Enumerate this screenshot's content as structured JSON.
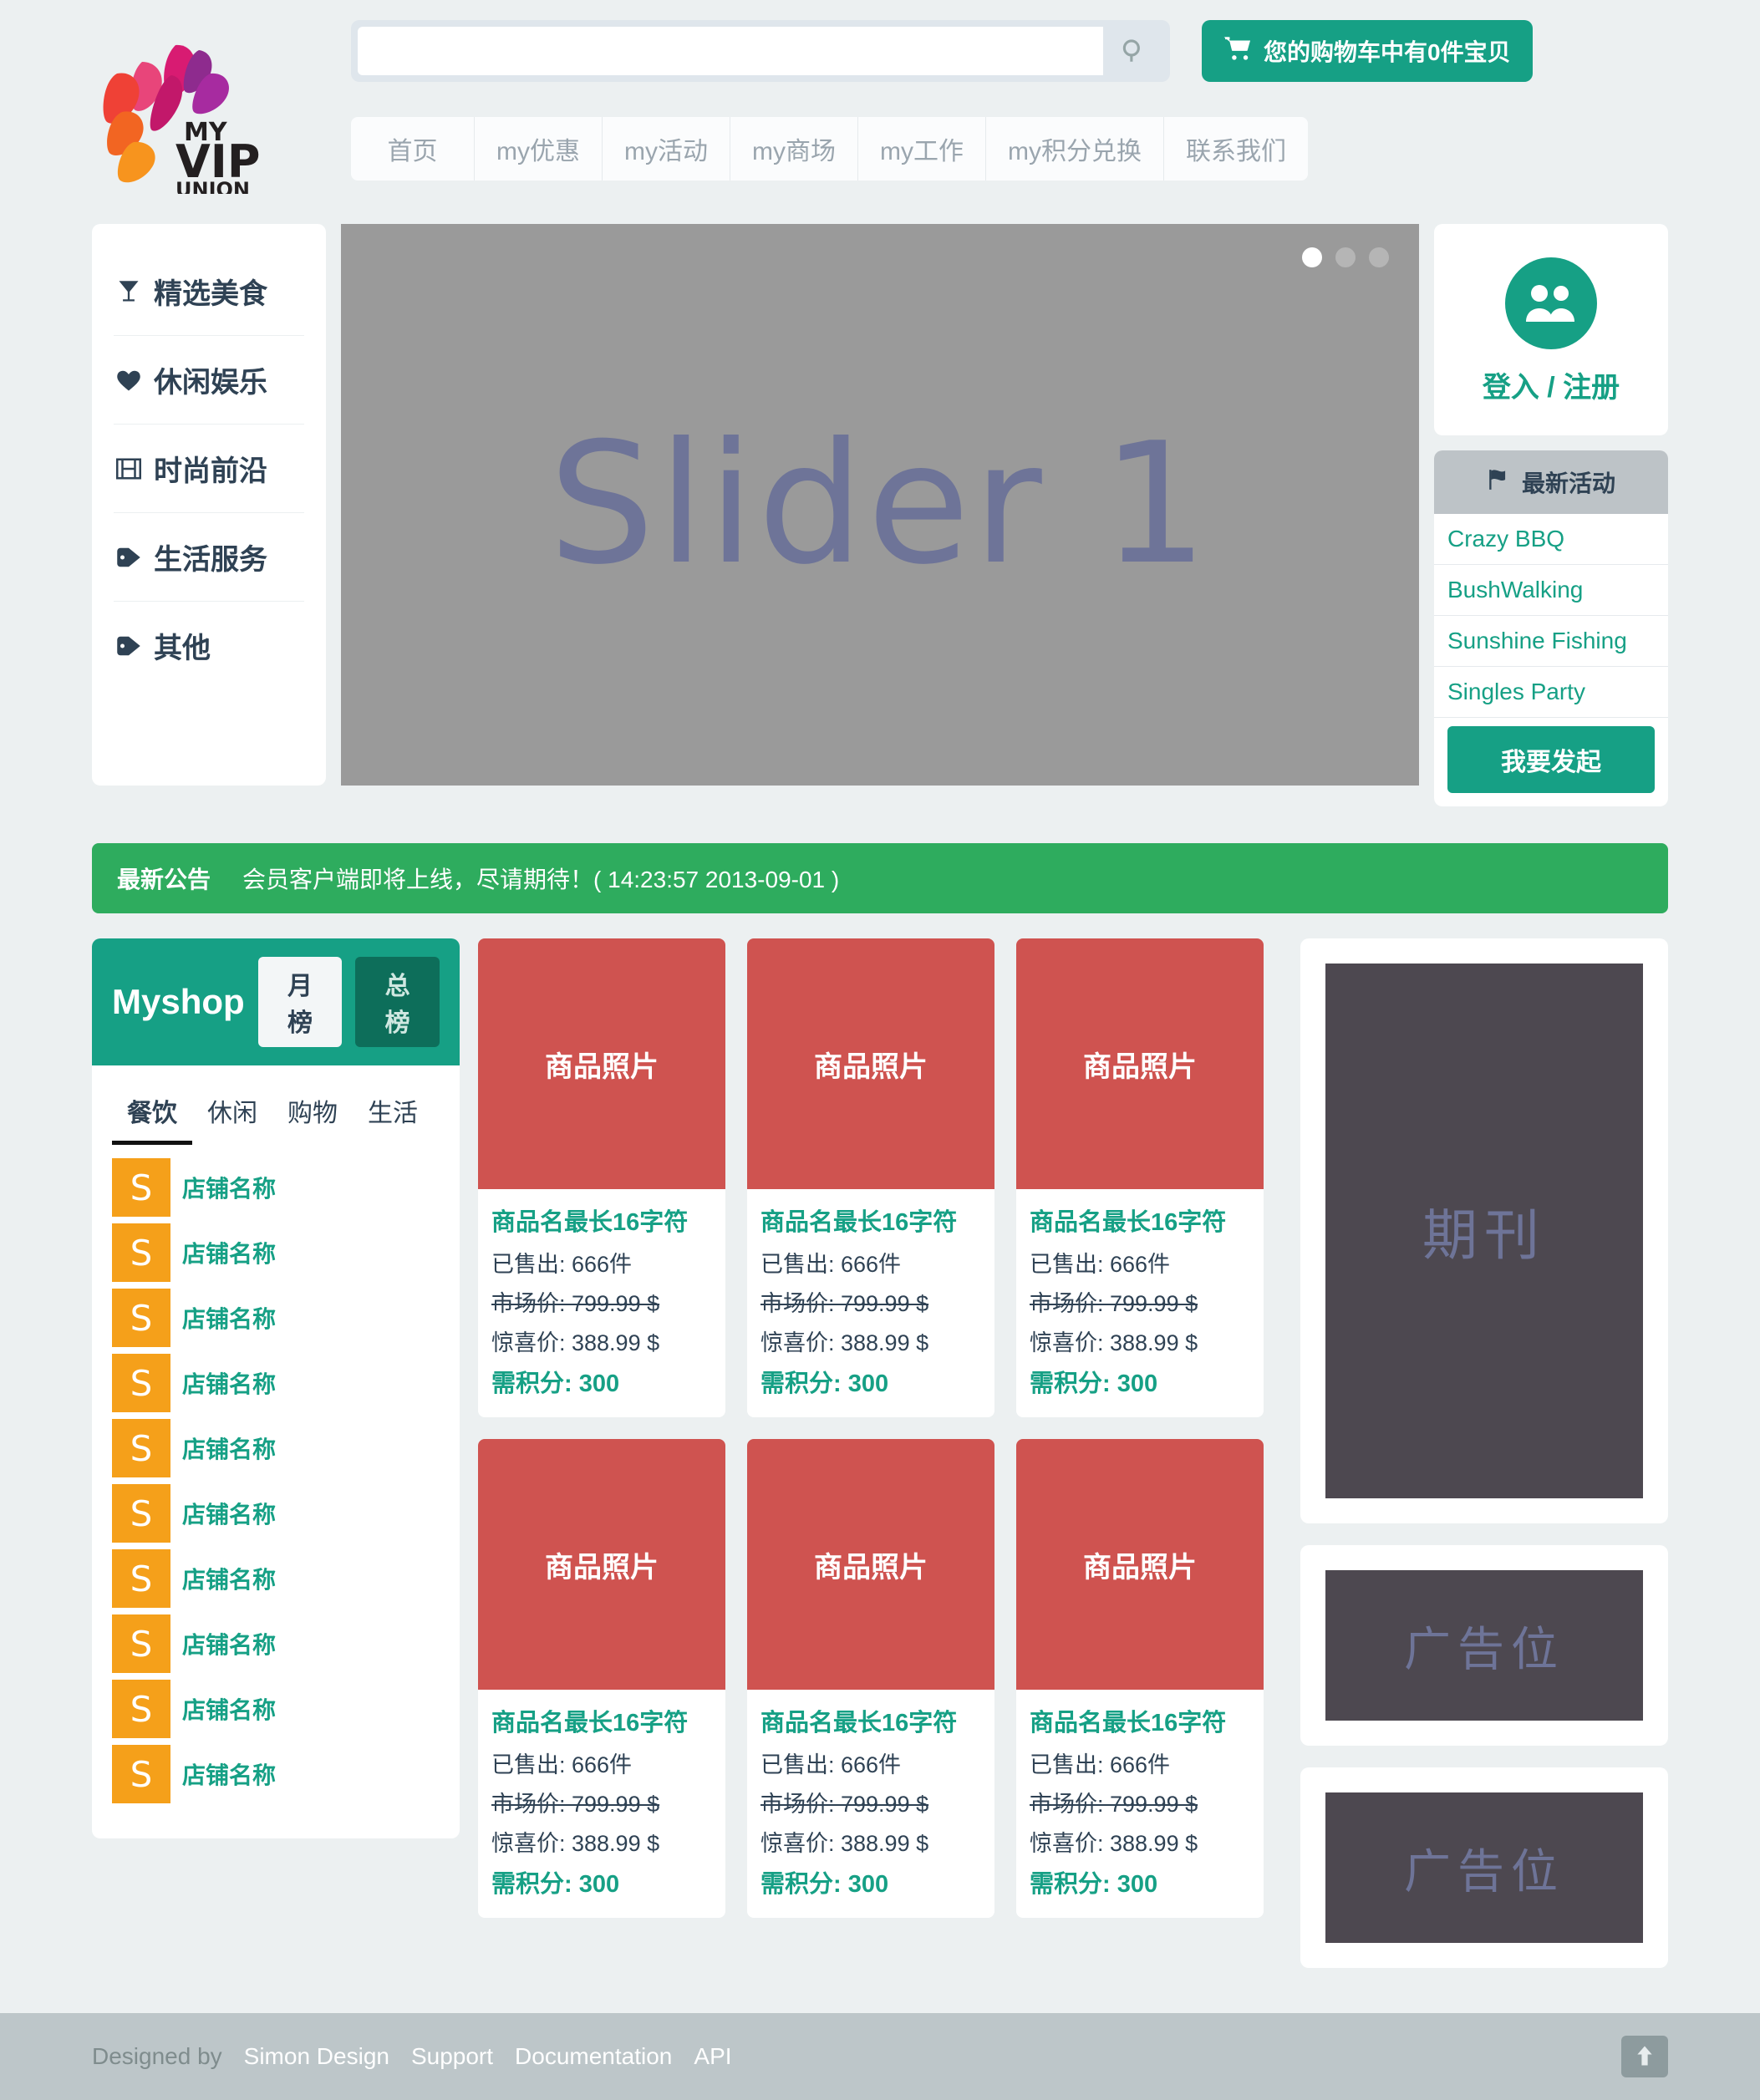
{
  "brand": {
    "name_my": "MY",
    "name_vip": "VIP",
    "name_union": "UNION"
  },
  "search": {
    "value": "",
    "placeholder": "",
    "icon": "search-icon"
  },
  "cart": {
    "label": "您的购物车中有0件宝贝",
    "icon": "shopping-cart-icon",
    "color": "#16a085"
  },
  "nav": {
    "items": [
      {
        "label": "首页"
      },
      {
        "label": "my优惠"
      },
      {
        "label": "my活动"
      },
      {
        "label": "my商场"
      },
      {
        "label": "my工作"
      },
      {
        "label": "my积分兑换"
      },
      {
        "label": "联系我们"
      }
    ]
  },
  "categories": {
    "items": [
      {
        "label": "精选美食",
        "icon": "cocktail-icon"
      },
      {
        "label": "休闲娱乐",
        "icon": "heart-icon"
      },
      {
        "label": "时尚前沿",
        "icon": "film-icon"
      },
      {
        "label": "生活服务",
        "icon": "tag-icon"
      },
      {
        "label": "其他",
        "icon": "tag-icon"
      }
    ]
  },
  "slider": {
    "text": "Slider 1",
    "background": "#9a9a9a",
    "text_color": "#6e7498",
    "dots": [
      {
        "active": true
      },
      {
        "active": false
      },
      {
        "active": false
      }
    ]
  },
  "login": {
    "label": "登入 / 注册",
    "icon": "users-icon",
    "color": "#16a085"
  },
  "activities": {
    "title": "最新活动",
    "title_icon": "flag-icon",
    "items": [
      {
        "label": "Crazy BBQ"
      },
      {
        "label": "BushWalking"
      },
      {
        "label": "Sunshine Fishing"
      },
      {
        "label": "Singles Party"
      }
    ],
    "button_label": "我要发起"
  },
  "announcement": {
    "title": "最新公告",
    "text": "会员客户端即将上线，尽请期待！( 14:23:57 2013-09-01 )",
    "color": "#2eac5e"
  },
  "myshop": {
    "title": "Myshop",
    "rank_month": "月榜",
    "rank_total": "总榜",
    "tabs": [
      {
        "label": "餐饮",
        "active": true
      },
      {
        "label": "休闲",
        "active": false
      },
      {
        "label": "购物",
        "active": false
      },
      {
        "label": "生活",
        "active": false
      }
    ],
    "shops": [
      {
        "logo": "S",
        "name": "店铺名称"
      },
      {
        "logo": "S",
        "name": "店铺名称"
      },
      {
        "logo": "S",
        "name": "店铺名称"
      },
      {
        "logo": "S",
        "name": "店铺名称"
      },
      {
        "logo": "S",
        "name": "店铺名称"
      },
      {
        "logo": "S",
        "name": "店铺名称"
      },
      {
        "logo": "S",
        "name": "店铺名称"
      },
      {
        "logo": "S",
        "name": "店铺名称"
      },
      {
        "logo": "S",
        "name": "店铺名称"
      },
      {
        "logo": "S",
        "name": "店铺名称"
      }
    ]
  },
  "products": {
    "items": [
      {
        "photo_label": "商品照片",
        "name": "商品名最长16字符",
        "sold": "已售出: 666件",
        "market_price": "市场价: 799.99 $",
        "sale_price": "惊喜价: 388.99 $",
        "points": "需积分: 300"
      },
      {
        "photo_label": "商品照片",
        "name": "商品名最长16字符",
        "sold": "已售出: 666件",
        "market_price": "市场价: 799.99 $",
        "sale_price": "惊喜价: 388.99 $",
        "points": "需积分: 300"
      },
      {
        "photo_label": "商品照片",
        "name": "商品名最长16字符",
        "sold": "已售出: 666件",
        "market_price": "市场价: 799.99 $",
        "sale_price": "惊喜价: 388.99 $",
        "points": "需积分: 300"
      },
      {
        "photo_label": "商品照片",
        "name": "商品名最长16字符",
        "sold": "已售出: 666件",
        "market_price": "市场价: 799.99 $",
        "sale_price": "惊喜价: 388.99 $",
        "points": "需积分: 300"
      },
      {
        "photo_label": "商品照片",
        "name": "商品名最长16字符",
        "sold": "已售出: 666件",
        "market_price": "市场价: 799.99 $",
        "sale_price": "惊喜价: 388.99 $",
        "points": "需积分: 300"
      },
      {
        "photo_label": "商品照片",
        "name": "商品名最长16字符",
        "sold": "已售出: 666件",
        "market_price": "市场价: 799.99 $",
        "sale_price": "惊喜价: 388.99 $",
        "points": "需积分: 300"
      }
    ]
  },
  "ads": {
    "journal_label": "期刊",
    "slot_1_label": "广告位",
    "slot_2_label": "广告位"
  },
  "footer": {
    "designed_by": "Designed by",
    "author": "Simon Design",
    "links": [
      {
        "label": "Support"
      },
      {
        "label": "Documentation"
      },
      {
        "label": "API"
      }
    ],
    "to_top_icon": "arrow-up-icon"
  }
}
